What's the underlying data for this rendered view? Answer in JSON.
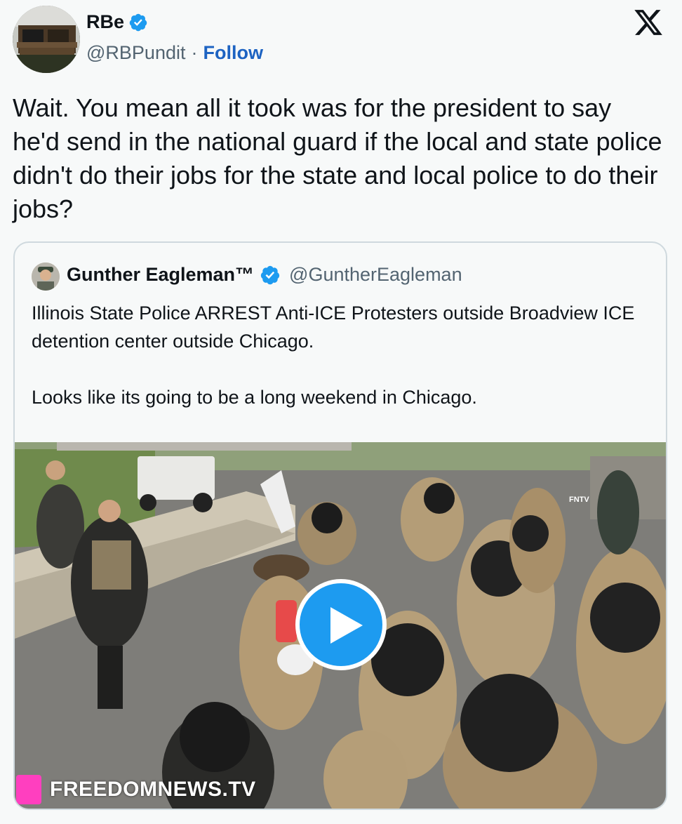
{
  "author": {
    "display_name": "RBe",
    "handle": "@RBPundit",
    "separator": "·",
    "follow_label": "Follow"
  },
  "tweet": {
    "text": "Wait. You mean all it took was for the president to say he'd send in the national guard if the local and state police didn't do their jobs for the state and local police to do their jobs?"
  },
  "quoted": {
    "display_name": "Gunther Eagleman™",
    "handle": "@GuntherEagleman",
    "paragraphs": [
      "Illinois State Police ARREST Anti-ICE Protesters outside Broadview ICE detention center outside Chicago.",
      "Looks like its going to be a long weekend in Chicago."
    ],
    "media": {
      "watermark": "FREEDOMNEWS.TV",
      "corner_tag": "FNTV"
    }
  },
  "icons": {
    "verified": "verified-badge-icon",
    "x_logo": "x-logo-icon",
    "play": "play-icon"
  },
  "colors": {
    "follow": "#1d63c2",
    "verified": "#1d9bf0",
    "play": "#1d9bf0",
    "watermark_box": "#ff3fbf"
  }
}
